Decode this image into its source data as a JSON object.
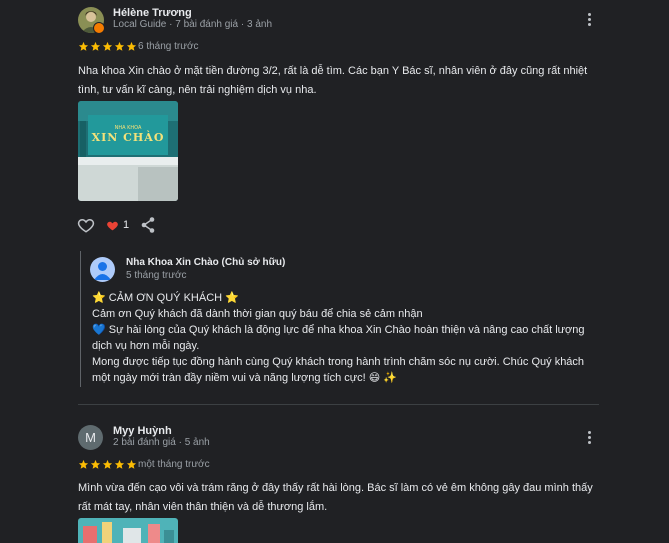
{
  "colors": {
    "background": "#202124",
    "star": "#fbbc04",
    "heart": "#ea4335",
    "text": "#e8eaed",
    "muted": "#9aa0a6"
  },
  "review1": {
    "author": "Hélène Trương",
    "meta": "Local Guide · 7 bài đánh giá · 3 ảnh",
    "rating": 5,
    "time": "6 tháng trước",
    "text": "Nha khoa Xin chào ở mặt tiền đường 3/2, rất là dễ tìm. Các bạn Y Bác sĩ, nhân viên ở đây cũng rất nhiệt tình, tư vấn kĩ càng, nên trải nghiệm dịch vụ nha.",
    "photo_sign": "XIN CHÀO",
    "photo_sign_small": "NHA KHOA",
    "like_count": "1",
    "icons": [
      "more-vert-icon",
      "heart-outline-icon",
      "heart-filled-icon",
      "share-icon"
    ]
  },
  "owner_reply": {
    "name": "Nha Khoa Xin Chào (Chủ sở hữu)",
    "time": "5 tháng trước",
    "line1": "⭐ CẢM ƠN QUÝ KHÁCH ⭐",
    "line2": "Cảm ơn Quý khách đã dành thời gian quý báu để chia sẻ cảm nhận",
    "line3a": "💙 Sự hài lòng của Quý khách là động lực để nha khoa Xin Chào hoàn thiện và nâng cao chất lượng",
    "line3b": "dịch vụ hơn mỗi ngày.",
    "line4a": "Mong được tiếp tục đồng hành cùng Quý khách trong hành trình chăm sóc nụ cười. Chúc Quý khách",
    "line4b": "một ngày mới tràn đầy niềm vui và năng lượng tích cực! 😄 ✨"
  },
  "review2": {
    "author": "Myy Huỳnh",
    "initial": "M",
    "meta": "2 bài đánh giá · 5 ảnh",
    "rating": 5,
    "time": "một tháng trước",
    "text": "Mình vừa đến cạo vôi và trám răng ở đây thấy rất hài lòng. Bác sĩ làm có vẻ êm không gây đau mình thấy rất mát tay, nhân viên thân thiện và dễ thương lắm."
  }
}
